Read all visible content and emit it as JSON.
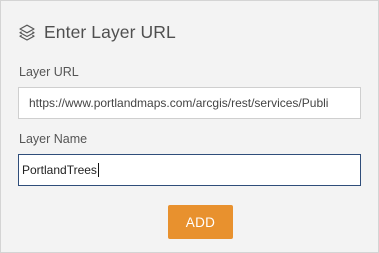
{
  "dialog": {
    "title": "Enter Layer URL",
    "icon": "layers-icon"
  },
  "form": {
    "url_label": "Layer URL",
    "url_value": "https://www.portlandmaps.com/arcgis/rest/services/Publi",
    "name_label": "Layer Name",
    "name_value": "PortlandTrees"
  },
  "actions": {
    "add_label": "ADD",
    "add_color": "#e8912e"
  },
  "colors": {
    "panel_background": "#f3f3f3",
    "focused_border": "#2f4d7a"
  }
}
